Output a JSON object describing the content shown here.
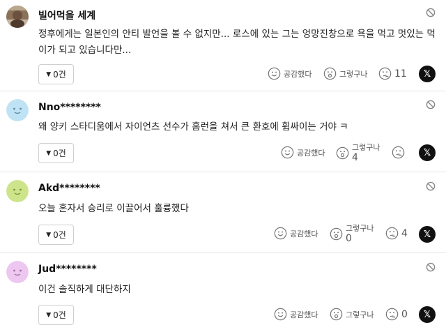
{
  "comments": [
    {
      "nickname": "빌어먹을 세계",
      "text": "정후에게는 일본인의 안티 발언을 볼 수 없지만... 로스에 있는 그는 엉망진창으로 욕을 먹고 멋있는 먹이가 되고 있습니다만...",
      "reply": "0건",
      "empathize_label": "공감했다",
      "wow_label": "그렇구나",
      "wow_count": "",
      "think_count": "11",
      "x_label": "𝕏",
      "avatar": "photo"
    },
    {
      "nickname": "Nno********",
      "text": "왜 양키 스타디움에서 자이언츠 선수가 홈런을 쳐서 큰 환호에 휩싸이는 거야 ㅋ",
      "reply": "0건",
      "empathize_label": "공감했다",
      "wow_label": "그렇구나",
      "wow_count": "4",
      "think_count": "",
      "x_label": "𝕏",
      "avatar": "blue"
    },
    {
      "nickname": "Akd********",
      "text": "오늘 혼자서 승리로 이끌어서 훌륭했다",
      "reply": "0건",
      "empathize_label": "공감했다",
      "wow_label": "그렇구나",
      "wow_count": "0",
      "think_count": "4",
      "x_label": "𝕏",
      "avatar": "green"
    },
    {
      "nickname": "Jud********",
      "text": "이건 솔직하게 대단하지",
      "reply": "0건",
      "empathize_label": "공감했다",
      "wow_label": "그렇구나",
      "wow_count": "",
      "think_count": "0",
      "x_label": "𝕏",
      "avatar": "pink"
    }
  ],
  "colors": {
    "blue_avatar": "#bfe3f4",
    "green_avatar": "#cde48a",
    "pink_avatar": "#edc7ef",
    "divider": "#e6e6e6"
  },
  "icons": [
    "block-icon",
    "smile-icon",
    "surprised-icon",
    "thinking-icon",
    "x-share-icon",
    "triangle-down-icon"
  ]
}
